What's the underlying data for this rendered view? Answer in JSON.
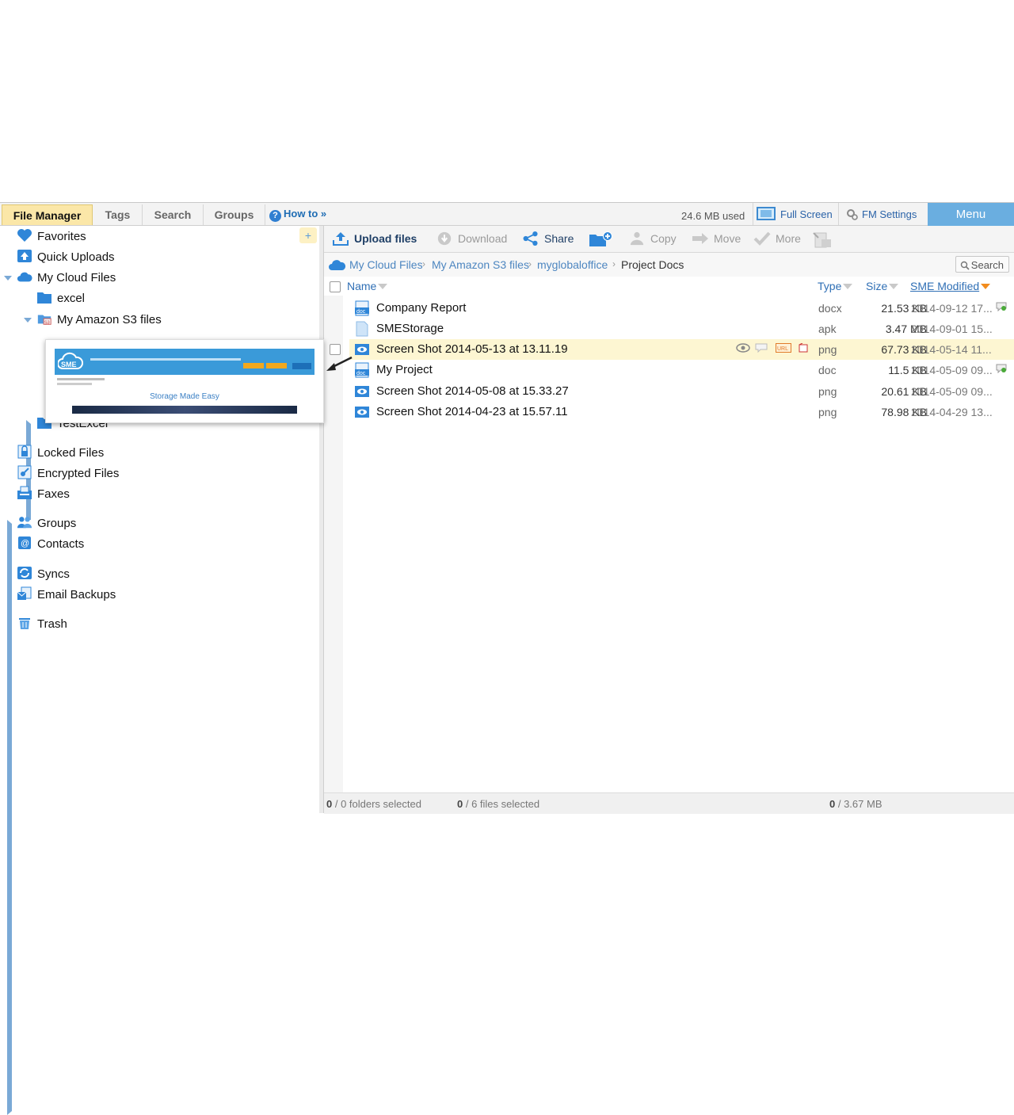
{
  "tabs": [
    {
      "label": "File Manager"
    },
    {
      "label": "Tags"
    },
    {
      "label": "Search"
    },
    {
      "label": "Groups"
    }
  ],
  "how_to": "How to »",
  "storage_used": "24.6 MB used",
  "full_screen": "Full Screen",
  "fm_settings": "FM Settings",
  "menu": "Menu",
  "tree": {
    "favorites": "Favorites",
    "quick_uploads": "Quick Uploads",
    "my_cloud_files": "My Cloud Files",
    "excel": "excel",
    "my_amazon_s3_files": "My Amazon S3 files",
    "testexcel": "TestExcel",
    "locked_files": "Locked Files",
    "encrypted_files": "Encrypted Files",
    "faxes": "Faxes",
    "groups": "Groups",
    "contacts": "Contacts",
    "syncs": "Syncs",
    "email_backups": "Email Backups",
    "trash": "Trash"
  },
  "popup": {
    "tagline": "Storage Made Easy",
    "logo": "SME"
  },
  "toolbar": {
    "upload": "Upload files",
    "download": "Download",
    "share": "Share",
    "copy": "Copy",
    "move": "Move",
    "more": "More"
  },
  "breadcrumb": [
    "My Cloud Files",
    "My Amazon S3 files",
    "myglobaloffice",
    "Project Docs"
  ],
  "search_label": "Search",
  "columns": {
    "name": "Name",
    "type": "Type",
    "size": "Size",
    "modified": "SME Modified"
  },
  "files": [
    {
      "name": "Company Report",
      "type": "docx",
      "size": "21.53 KB",
      "modified": "2014-09-12 17...",
      "icon": "doc-icon"
    },
    {
      "name": "SMEStorage",
      "type": "apk",
      "size": "3.47 MB",
      "modified": "2014-09-01 15...",
      "icon": "generic-file-icon"
    },
    {
      "name": "Screen Shot 2014-05-13 at 13.11.19",
      "type": "png",
      "size": "67.73 KB",
      "modified": "2014-05-14 11...",
      "icon": "image-icon"
    },
    {
      "name": "My Project",
      "type": "doc",
      "size": "11.5 KB",
      "modified": "2014-05-09 09...",
      "icon": "doc-icon"
    },
    {
      "name": "Screen Shot 2014-05-08 at 15.33.27",
      "type": "png",
      "size": "20.61 KB",
      "modified": "2014-05-09 09...",
      "icon": "image-icon"
    },
    {
      "name": "Screen Shot 2014-04-23 at 15.57.11",
      "type": "png",
      "size": "78.98 KB",
      "modified": "2014-04-29 13...",
      "icon": "image-icon"
    }
  ],
  "status": {
    "folders_selected": "0",
    "folders_total": " / 0 folders selected",
    "files_selected": "0",
    "files_total": " / 6 files selected",
    "size_selected": "0",
    "size_total": " / 3.67 MB"
  },
  "colors": {
    "accent": "#6aaee0",
    "active_tab": "#fbe7a8",
    "selected_row": "#fdf6d2",
    "link": "#2f6fb5"
  }
}
